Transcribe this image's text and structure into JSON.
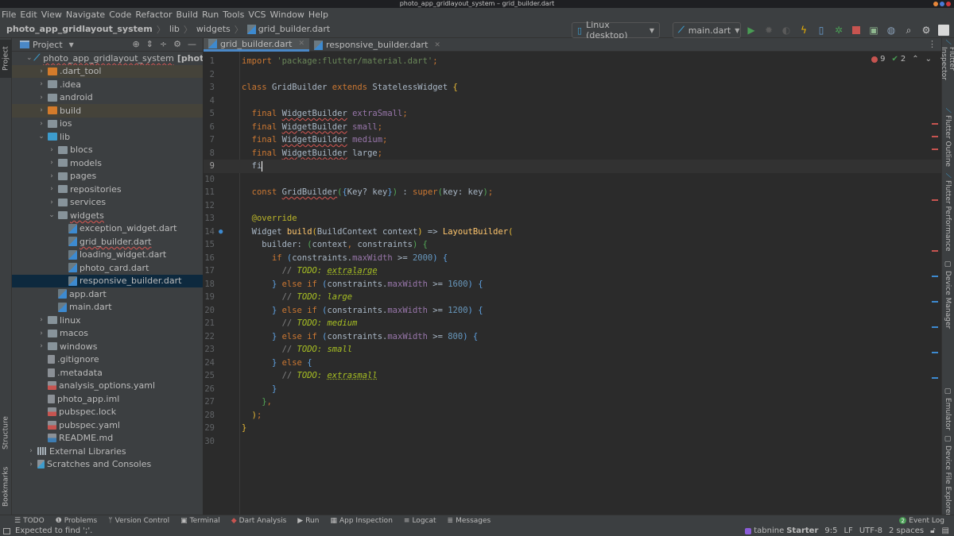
{
  "window": {
    "title": "photo_app_gridlayout_system – grid_builder.dart"
  },
  "menu": [
    "File",
    "Edit",
    "View",
    "Navigate",
    "Code",
    "Refactor",
    "Build",
    "Run",
    "Tools",
    "VCS",
    "Window",
    "Help"
  ],
  "breadcrumb": {
    "project": "photo_app_gridlayout_system",
    "items": [
      "lib",
      "widgets",
      "grid_builder.dart"
    ]
  },
  "toolbar": {
    "device_selector": "Linux (desktop)",
    "run_config": "main.dart",
    "icons": [
      "run-icon",
      "debug-icon",
      "attach-debugger-icon",
      "hot-reload-icon",
      "device-mirror-icon",
      "profile-icon",
      "stop-icon",
      "avd-manager-icon",
      "sdk-manager-icon",
      "search-icon",
      "settings-icon",
      "account-icon"
    ]
  },
  "colors": {
    "accent": "#4a88c7",
    "error": "#c75450",
    "success": "#499c54",
    "selection": "#0d293e"
  },
  "project_panel": {
    "title": "Project",
    "root": {
      "name": "photo_app_gridlayout_system",
      "module": "[photo_app]",
      "path": "~/"
    },
    "tree": [
      {
        "label": ".dart_tool",
        "depth": 1,
        "type": "folder-excluded",
        "arrow": "collapsed",
        "hl": "yellow"
      },
      {
        "label": ".idea",
        "depth": 1,
        "type": "folder",
        "arrow": "collapsed"
      },
      {
        "label": "android",
        "depth": 1,
        "type": "folder",
        "arrow": "collapsed"
      },
      {
        "label": "build",
        "depth": 1,
        "type": "folder-excluded",
        "arrow": "collapsed",
        "hl": "yellow"
      },
      {
        "label": "ios",
        "depth": 1,
        "type": "folder",
        "arrow": "collapsed"
      },
      {
        "label": "lib",
        "depth": 1,
        "type": "folder-source",
        "arrow": "expanded"
      },
      {
        "label": "blocs",
        "depth": 2,
        "type": "folder",
        "arrow": "collapsed"
      },
      {
        "label": "models",
        "depth": 2,
        "type": "folder",
        "arrow": "collapsed"
      },
      {
        "label": "pages",
        "depth": 2,
        "type": "folder",
        "arrow": "collapsed"
      },
      {
        "label": "repositories",
        "depth": 2,
        "type": "folder",
        "arrow": "collapsed"
      },
      {
        "label": "services",
        "depth": 2,
        "type": "folder",
        "arrow": "collapsed"
      },
      {
        "label": "widgets",
        "depth": 2,
        "type": "folder",
        "arrow": "expanded",
        "error": true
      },
      {
        "label": "exception_widget.dart",
        "depth": 3,
        "type": "dart"
      },
      {
        "label": "grid_builder.dart",
        "depth": 3,
        "type": "dart",
        "error": true
      },
      {
        "label": "loading_widget.dart",
        "depth": 3,
        "type": "dart"
      },
      {
        "label": "photo_card.dart",
        "depth": 3,
        "type": "dart"
      },
      {
        "label": "responsive_builder.dart",
        "depth": 3,
        "type": "dart",
        "selected": true
      },
      {
        "label": "app.dart",
        "depth": 2,
        "type": "dart"
      },
      {
        "label": "main.dart",
        "depth": 2,
        "type": "dart"
      },
      {
        "label": "linux",
        "depth": 1,
        "type": "folder",
        "arrow": "collapsed"
      },
      {
        "label": "macos",
        "depth": 1,
        "type": "folder",
        "arrow": "collapsed"
      },
      {
        "label": "windows",
        "depth": 1,
        "type": "folder",
        "arrow": "collapsed"
      },
      {
        "label": ".gitignore",
        "depth": 1,
        "type": "file"
      },
      {
        "label": ".metadata",
        "depth": 1,
        "type": "file"
      },
      {
        "label": "analysis_options.yaml",
        "depth": 1,
        "type": "yaml"
      },
      {
        "label": "photo_app.iml",
        "depth": 1,
        "type": "file"
      },
      {
        "label": "pubspec.lock",
        "depth": 1,
        "type": "yaml"
      },
      {
        "label": "pubspec.yaml",
        "depth": 1,
        "type": "yaml"
      },
      {
        "label": "README.md",
        "depth": 1,
        "type": "md"
      },
      {
        "label": "External Libraries",
        "depth": 0,
        "type": "lib",
        "arrow": "collapsed"
      },
      {
        "label": "Scratches and Consoles",
        "depth": 0,
        "type": "scratch",
        "arrow": "collapsed"
      }
    ]
  },
  "left_strip": {
    "top": "Project",
    "structure": "Structure",
    "bookmarks": "Bookmarks"
  },
  "tabs": [
    {
      "label": "grid_builder.dart",
      "active": true
    },
    {
      "label": "responsive_builder.dart",
      "active": false
    }
  ],
  "inspections": {
    "errors": "9",
    "weak_warnings": "2"
  },
  "editor": {
    "current_line": 9,
    "cursor_position": "9:5",
    "lines": [
      [
        [
          "kw",
          "import "
        ],
        [
          "str",
          "'package:flutter/material.dart'"
        ],
        [
          "kw",
          ";"
        ]
      ],
      [],
      [
        [
          "kw",
          "class "
        ],
        [
          "pl",
          "GridBuilder "
        ],
        [
          "kw",
          "extends "
        ],
        [
          "pl",
          "StatelessWidget "
        ],
        [
          "br",
          "{"
        ]
      ],
      [],
      [
        [
          "pl",
          "  "
        ],
        [
          "kw",
          "final "
        ],
        [
          "pl wavy",
          "WidgetBuilder"
        ],
        [
          "fld",
          " extraSmall"
        ],
        [
          "kw",
          ";"
        ]
      ],
      [
        [
          "pl",
          "  "
        ],
        [
          "kw",
          "final "
        ],
        [
          "pl wavy",
          "WidgetBuilder"
        ],
        [
          "fld",
          " small"
        ],
        [
          "kw",
          ";"
        ]
      ],
      [
        [
          "pl",
          "  "
        ],
        [
          "kw",
          "final "
        ],
        [
          "pl wavy",
          "WidgetBuilder"
        ],
        [
          "fld",
          " medium"
        ],
        [
          "kw",
          ";"
        ]
      ],
      [
        [
          "pl",
          "  "
        ],
        [
          "kw",
          "final "
        ],
        [
          "pl wavy",
          "WidgetBuilder"
        ],
        [
          "pl",
          " large"
        ],
        [
          "kw",
          ";"
        ]
      ],
      [
        [
          "pl",
          "  fi"
        ]
      ],
      [],
      [
        [
          "pl",
          "  "
        ],
        [
          "kw",
          "const "
        ],
        [
          "pl wavy",
          "GridBuilder"
        ],
        [
          "br2",
          "("
        ],
        [
          "br3",
          "{"
        ],
        [
          "pl",
          "Key? key"
        ],
        [
          "br3",
          "}"
        ],
        [
          "br2",
          ")"
        ],
        [
          "pl",
          " : "
        ],
        [
          "kw",
          "super"
        ],
        [
          "br2",
          "("
        ],
        [
          "pl",
          "key: key"
        ],
        [
          "br2",
          ")"
        ],
        [
          "kw",
          ";"
        ]
      ],
      [],
      [
        [
          "ann",
          "  @override"
        ]
      ],
      [
        [
          "pl",
          "  Widget "
        ],
        [
          "fn",
          "build"
        ],
        [
          "br",
          "("
        ],
        [
          "pl",
          "BuildContext context"
        ],
        [
          "br",
          ")"
        ],
        [
          "pl",
          " => "
        ],
        [
          "fn",
          "LayoutBuilder"
        ],
        [
          "br",
          "("
        ]
      ],
      [
        [
          "pl",
          "    builder: "
        ],
        [
          "br2",
          "("
        ],
        [
          "pl",
          "context"
        ],
        [
          "kw",
          ", "
        ],
        [
          "pl",
          "constraints"
        ],
        [
          "br2",
          ")"
        ],
        [
          "pl",
          " "
        ],
        [
          "br2",
          "{"
        ]
      ],
      [
        [
          "pl",
          "      "
        ],
        [
          "kw",
          "if "
        ],
        [
          "br3",
          "("
        ],
        [
          "pl",
          "constraints."
        ],
        [
          "fld",
          "maxWidth"
        ],
        [
          "pl",
          " >= "
        ],
        [
          "num",
          "2000"
        ],
        [
          "br3",
          ")"
        ],
        [
          "pl",
          " "
        ],
        [
          "br3",
          "{"
        ]
      ],
      [
        [
          "pl",
          "        "
        ],
        [
          "cmt",
          "// "
        ],
        [
          "todo",
          "TODO: "
        ],
        [
          "todo wavy2",
          "extralarge"
        ]
      ],
      [
        [
          "pl",
          "      "
        ],
        [
          "br3",
          "}"
        ],
        [
          "kw",
          " else if "
        ],
        [
          "br3",
          "("
        ],
        [
          "pl",
          "constraints."
        ],
        [
          "fld",
          "maxWidth"
        ],
        [
          "pl",
          " >= "
        ],
        [
          "num",
          "1600"
        ],
        [
          "br3",
          ")"
        ],
        [
          "pl",
          " "
        ],
        [
          "br3",
          "{"
        ]
      ],
      [
        [
          "pl",
          "        "
        ],
        [
          "cmt",
          "// "
        ],
        [
          "todo",
          "TODO: large"
        ]
      ],
      [
        [
          "pl",
          "      "
        ],
        [
          "br3",
          "}"
        ],
        [
          "kw",
          " else if "
        ],
        [
          "br3",
          "("
        ],
        [
          "pl",
          "constraints."
        ],
        [
          "fld",
          "maxWidth"
        ],
        [
          "pl",
          " >= "
        ],
        [
          "num",
          "1200"
        ],
        [
          "br3",
          ")"
        ],
        [
          "pl",
          " "
        ],
        [
          "br3",
          "{"
        ]
      ],
      [
        [
          "pl",
          "        "
        ],
        [
          "cmt",
          "// "
        ],
        [
          "todo",
          "TODO: medium"
        ]
      ],
      [
        [
          "pl",
          "      "
        ],
        [
          "br3",
          "}"
        ],
        [
          "kw",
          " else if "
        ],
        [
          "br3",
          "("
        ],
        [
          "pl",
          "constraints."
        ],
        [
          "fld",
          "maxWidth"
        ],
        [
          "pl",
          " >= "
        ],
        [
          "num",
          "800"
        ],
        [
          "br3",
          ")"
        ],
        [
          "pl",
          " "
        ],
        [
          "br3",
          "{"
        ]
      ],
      [
        [
          "pl",
          "        "
        ],
        [
          "cmt",
          "// "
        ],
        [
          "todo",
          "TODO: small"
        ]
      ],
      [
        [
          "pl",
          "      "
        ],
        [
          "br3",
          "}"
        ],
        [
          "kw",
          " else "
        ],
        [
          "br3",
          "{"
        ]
      ],
      [
        [
          "pl",
          "        "
        ],
        [
          "cmt",
          "// "
        ],
        [
          "todo",
          "TODO: "
        ],
        [
          "todo wavy2",
          "extrasmall"
        ]
      ],
      [
        [
          "pl",
          "      "
        ],
        [
          "br3",
          "}"
        ]
      ],
      [
        [
          "pl",
          "    "
        ],
        [
          "br2",
          "}"
        ],
        [
          "kw",
          ","
        ]
      ],
      [
        [
          "pl",
          "  "
        ],
        [
          "br",
          ")"
        ],
        [
          "kw",
          ";"
        ]
      ],
      [
        [
          "br",
          "}"
        ]
      ],
      []
    ]
  },
  "right_strip": [
    "Flutter Inspector",
    "Flutter Outline",
    "Flutter Performance",
    "Device Manager",
    "Emulator",
    "Device File Explorer"
  ],
  "bottom_tools": [
    {
      "icon": "todo-icon",
      "label": "TODO"
    },
    {
      "icon": "problems-icon",
      "label": "Problems"
    },
    {
      "icon": "version-control-icon",
      "label": "Version Control"
    },
    {
      "icon": "terminal-icon",
      "label": "Terminal"
    },
    {
      "icon": "dart-analysis-icon",
      "label": "Dart Analysis"
    },
    {
      "icon": "run-icon",
      "label": "Run"
    },
    {
      "icon": "app-inspection-icon",
      "label": "App Inspection"
    },
    {
      "icon": "logcat-icon",
      "label": "Logcat"
    },
    {
      "icon": "messages-icon",
      "label": "Messages"
    }
  ],
  "event_log": {
    "count": "2",
    "label": "Event Log"
  },
  "status": {
    "message": "Expected to find ';'.",
    "tabnine": "tabnine",
    "tabnine_plan": "Starter",
    "position": "9:5",
    "line_sep": "LF",
    "encoding": "UTF-8",
    "indent": "2 spaces"
  }
}
